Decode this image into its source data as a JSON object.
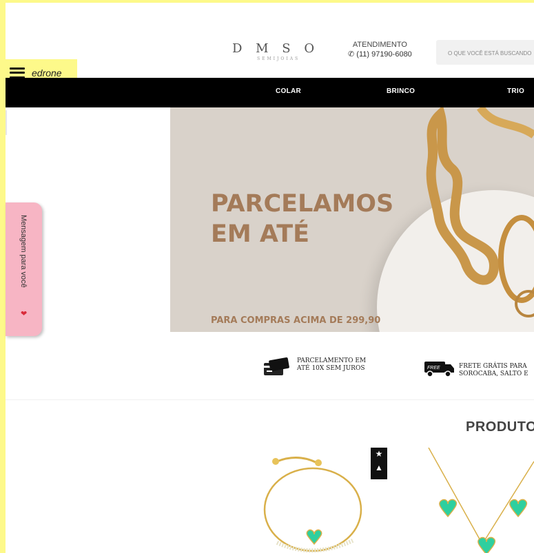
{
  "header": {
    "logo": "D M S O",
    "logo_sub": "SEMIJOIAS",
    "atendimento_label": "ATENDIMENTO",
    "phone": "(11) 97190-6080",
    "search_placeholder": "O QUE VOCÊ ESTÁ BUSCANDO"
  },
  "edrone": {
    "label": "edrone"
  },
  "nav": {
    "items": [
      "COLAR",
      "BRINCO",
      "TRIO"
    ]
  },
  "hero": {
    "title_line1": "PARCELAMOS",
    "title_line2": "EM ATÉ",
    "subtitle": "PARA COMPRAS ACIMA DE 299,90"
  },
  "message_tab": {
    "label": "Mensagem para você"
  },
  "features": [
    {
      "line1": "PARCELAMENTO EM",
      "line2": "ATÉ 10X SEM JUROS"
    },
    {
      "line1": "FRETE GRÁTIS PARA",
      "line2": "SOROCABA, SALTO E"
    }
  ],
  "products_section": {
    "title": "PRODUTOS"
  },
  "colors": {
    "frame": "#fdf98a",
    "nav_bg": "#000000",
    "hero_text": "#a47b59",
    "message_tab": "#f7b5c4",
    "gem": "#2ecf9f"
  }
}
